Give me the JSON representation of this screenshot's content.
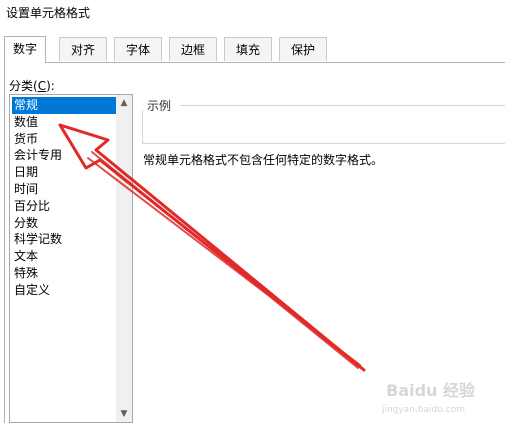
{
  "dialog": {
    "title": "设置单元格格式"
  },
  "tabs": [
    {
      "label": "数字",
      "active": true
    },
    {
      "label": "对齐",
      "active": false
    },
    {
      "label": "字体",
      "active": false
    },
    {
      "label": "边框",
      "active": false
    },
    {
      "label": "填充",
      "active": false
    },
    {
      "label": "保护",
      "active": false
    }
  ],
  "category": {
    "label_prefix": "分类(",
    "label_key": "C",
    "label_suffix": "):",
    "items": [
      "常规",
      "数值",
      "货币",
      "会计专用",
      "日期",
      "时间",
      "百分比",
      "分数",
      "科学记数",
      "文本",
      "特殊",
      "自定义"
    ],
    "selected_index": 0
  },
  "sample": {
    "label": "示例"
  },
  "description": "常规单元格格式不包含任何特定的数字格式。",
  "annotation": {
    "arrow_color": "#e02a2a",
    "points_to": "数值"
  },
  "watermark": {
    "text": "Baidu 经验",
    "sub": "jingyan.baidu.com"
  },
  "colors": {
    "selection": "#0078d7"
  }
}
